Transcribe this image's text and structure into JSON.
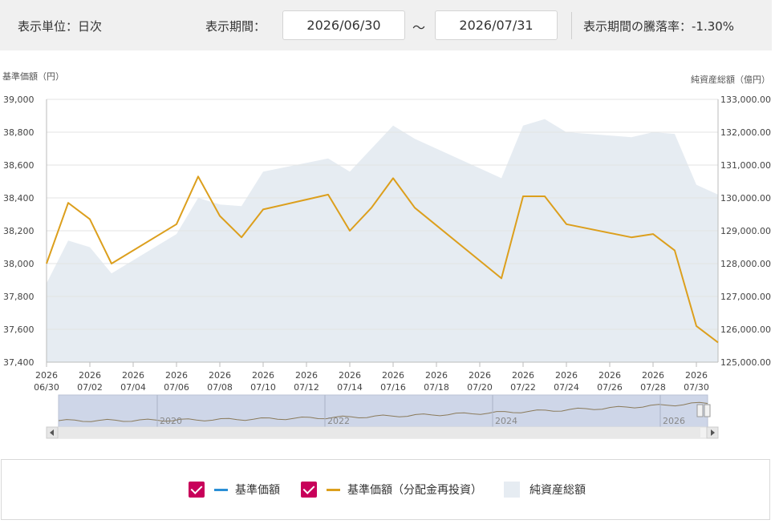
{
  "controls": {
    "unit_label": "表示単位：日次",
    "period_label": "表示期間：",
    "date_from": "2026/06/30",
    "tilde": "〜",
    "date_to": "2026/07/31",
    "change_label": "表示期間の騰落率：-1.30%"
  },
  "chart_data": {
    "type": "line",
    "left_axis_title": "基準価額（円）",
    "right_axis_title": "純資産総額（億円）",
    "y_left": {
      "min": 37400,
      "max": 39000,
      "ticks": [
        37400,
        37600,
        37800,
        38000,
        38200,
        38400,
        38600,
        38800,
        39000
      ],
      "tick_labels": [
        "37,400",
        "37,600",
        "37,800",
        "38,000",
        "38,200",
        "38,400",
        "38,600",
        "38,800",
        "39,000"
      ]
    },
    "y_right": {
      "min": 125000,
      "max": 133000,
      "ticks": [
        125000,
        126000,
        127000,
        128000,
        129000,
        130000,
        131000,
        132000,
        133000
      ],
      "tick_labels": [
        "125,000.00",
        "126,000.00",
        "127,000.00",
        "128,000.00",
        "129,000.00",
        "130,000.00",
        "131,000.00",
        "132,000.00",
        "133,000.00"
      ]
    },
    "x_ticks": [
      {
        "day": 0,
        "line1": "2026",
        "line2": "06/30"
      },
      {
        "day": 2,
        "line1": "2026",
        "line2": "07/02"
      },
      {
        "day": 4,
        "line1": "2026",
        "line2": "07/04"
      },
      {
        "day": 6,
        "line1": "2026",
        "line2": "07/06"
      },
      {
        "day": 8,
        "line1": "2026",
        "line2": "07/08"
      },
      {
        "day": 10,
        "line1": "2026",
        "line2": "07/10"
      },
      {
        "day": 12,
        "line1": "2026",
        "line2": "07/12"
      },
      {
        "day": 14,
        "line1": "2026",
        "line2": "07/14"
      },
      {
        "day": 16,
        "line1": "2026",
        "line2": "07/16"
      },
      {
        "day": 18,
        "line1": "2026",
        "line2": "07/18"
      },
      {
        "day": 20,
        "line1": "2026",
        "line2": "07/20"
      },
      {
        "day": 22,
        "line1": "2026",
        "line2": "07/22"
      },
      {
        "day": 24,
        "line1": "2026",
        "line2": "07/24"
      },
      {
        "day": 26,
        "line1": "2026",
        "line2": "07/26"
      },
      {
        "day": 28,
        "line1": "2026",
        "line2": "07/28"
      },
      {
        "day": 30,
        "line1": "2026",
        "line2": "07/30"
      }
    ],
    "x_range": [
      0,
      31
    ],
    "series": [
      {
        "name": "基準価額（分配金再投資）",
        "axis": "left",
        "color": "#dc9f1d",
        "points": [
          [
            0,
            38000
          ],
          [
            1,
            38370
          ],
          [
            2,
            38270
          ],
          [
            3,
            38000
          ],
          [
            6,
            38240
          ],
          [
            7,
            38530
          ],
          [
            8,
            38290
          ],
          [
            9,
            38160
          ],
          [
            10,
            38330
          ],
          [
            13,
            38420
          ],
          [
            14,
            38200
          ],
          [
            15,
            38340
          ],
          [
            16,
            38520
          ],
          [
            17,
            38340
          ],
          [
            21,
            37910
          ],
          [
            22,
            38410
          ],
          [
            23,
            38410
          ],
          [
            24,
            38240
          ],
          [
            27,
            38160
          ],
          [
            28,
            38180
          ],
          [
            29,
            38080
          ],
          [
            30,
            37620
          ],
          [
            31,
            37520
          ]
        ]
      },
      {
        "name": "純資産総額",
        "axis": "right",
        "type": "area",
        "color": "#e6ecf2",
        "points": [
          [
            0,
            127400
          ],
          [
            1,
            128700
          ],
          [
            2,
            128500
          ],
          [
            3,
            127700
          ],
          [
            6,
            128900
          ],
          [
            7,
            130000
          ],
          [
            8,
            129800
          ],
          [
            9,
            129750
          ],
          [
            10,
            130800
          ],
          [
            13,
            131200
          ],
          [
            14,
            130800
          ],
          [
            15,
            131500
          ],
          [
            16,
            132200
          ],
          [
            17,
            131800
          ],
          [
            21,
            130600
          ],
          [
            22,
            132200
          ],
          [
            23,
            132400
          ],
          [
            24,
            132000
          ],
          [
            27,
            131850
          ],
          [
            28,
            132000
          ],
          [
            29,
            131950
          ],
          [
            30,
            130400
          ],
          [
            31,
            130100
          ]
        ]
      }
    ],
    "navigator": {
      "labels": [
        "2020",
        "2022",
        "2024",
        "2026"
      ]
    },
    "grid": true
  },
  "legend": {
    "items": [
      {
        "label": "基準価額",
        "color": "#2a8fd6",
        "checked": true,
        "kind": "line"
      },
      {
        "label": "基準価額（分配金再投資）",
        "color": "#dc9f1d",
        "checked": true,
        "kind": "line"
      },
      {
        "label": "純資産総額",
        "color": "#e6ecf2",
        "kind": "area"
      }
    ]
  }
}
